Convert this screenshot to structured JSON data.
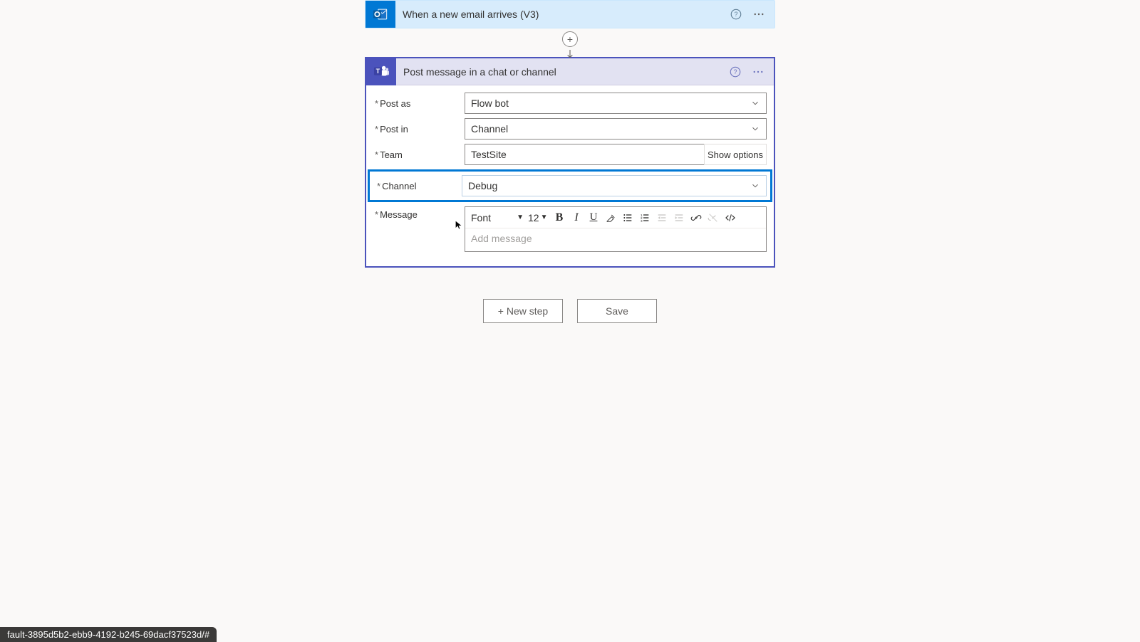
{
  "trigger": {
    "title": "When a new email arrives (V3)"
  },
  "action": {
    "title": "Post message in a chat or channel",
    "fields": {
      "post_as": {
        "label": "Post as",
        "value": "Flow bot"
      },
      "post_in": {
        "label": "Post in",
        "value": "Channel"
      },
      "team": {
        "label": "Team",
        "value": "TestSite",
        "show_options_label": "Show options"
      },
      "channel": {
        "label": "Channel",
        "value": "Debug"
      },
      "message": {
        "label": "Message",
        "placeholder": "Add message"
      }
    },
    "toolbar": {
      "font_label": "Font",
      "size": "12"
    }
  },
  "buttons": {
    "new_step": "+ New step",
    "save": "Save"
  },
  "status_url": "fault-3895d5b2-ebb9-4192-b245-69dacf37523d/#"
}
